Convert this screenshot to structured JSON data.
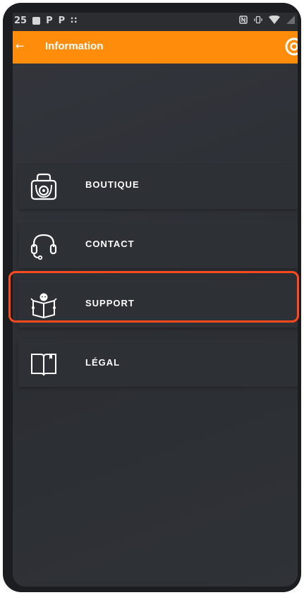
{
  "status_bar": {
    "time": "25",
    "notification_icons": [
      "image-icon",
      "parking-icon",
      "parking-icon",
      "grid-icon"
    ],
    "system_icons": [
      "nfc-icon",
      "vibrate-icon",
      "wifi-icon",
      "battery-icon"
    ]
  },
  "app_bar": {
    "back_icon": "back-arrow-icon",
    "title": "Information",
    "logo_icon": "logo-icon",
    "color": "#ff8c0a"
  },
  "menu": {
    "items": [
      {
        "label": "BOUTIQUE",
        "icon": "shopping-bag-icon"
      },
      {
        "label": "CONTACT",
        "icon": "headset-icon"
      },
      {
        "label": "SUPPORT",
        "icon": "support-book-icon",
        "highlighted": true
      },
      {
        "label": "LÉGAL",
        "icon": "book-icon"
      }
    ]
  },
  "colors": {
    "background": "#2f3237",
    "highlight": "#ff4a1f"
  }
}
